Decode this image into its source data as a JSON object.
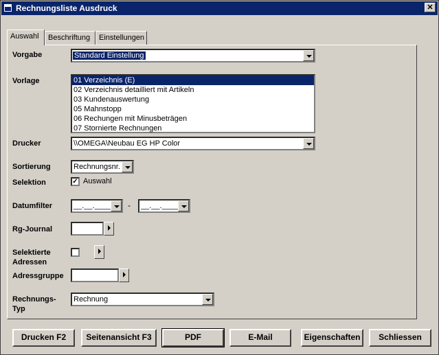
{
  "window": {
    "title": "Rechnungsliste Ausdruck",
    "close_glyph": "✕"
  },
  "tabs": [
    {
      "label": "Auswahl",
      "active": true
    },
    {
      "label": "Beschriftung",
      "active": false
    },
    {
      "label": "Einstellungen",
      "active": false
    }
  ],
  "form": {
    "vorgabe": {
      "label": "Vorgabe",
      "value": "Standard Einstellung"
    },
    "vorlage": {
      "label": "Vorlage",
      "items": [
        "01 Verzeichnis (E)",
        "02 Verzeichnis detailliert mit Artikeln",
        "03 Kundenauswertung",
        "05 Mahnstopp",
        "06 Rechungen mit Minusbeträgen",
        "07 Stornierte Rechnungen"
      ],
      "selected_index": 0
    },
    "drucker": {
      "label": "Drucker",
      "value": "\\\\OMEGA\\Neubau EG HP Color"
    },
    "sortierung": {
      "label": "Sortierung",
      "value": "Rechnungsnr."
    },
    "selektion": {
      "label": "Selektion",
      "checkbox_label": "Auswahl",
      "checked": true,
      "check_glyph": "✓"
    },
    "datumfilter": {
      "label": "Datumfilter",
      "from": "__.__.____",
      "to": "__.__.____",
      "separator": "-"
    },
    "rg_journal": {
      "label": "Rg-Journal",
      "value": ""
    },
    "selektierte_adressen": {
      "label_line1": "Selektierte",
      "label_line2": "Adressen",
      "checked": false
    },
    "adressgruppe": {
      "label": "Adressgruppe",
      "value": ""
    },
    "rechnungs_typ": {
      "label_line1": "Rechnungs-",
      "label_line2": "Typ",
      "value": "Rechnung"
    }
  },
  "buttons": {
    "drucken": "Drucken F2",
    "seitenansicht": "Seitenansicht F3",
    "pdf": "PDF",
    "email": "E-Mail",
    "eigenschaften": "Eigenschaften",
    "schliessen": "Schliessen"
  },
  "colors": {
    "titlebar": "#0a246a",
    "face": "#d4d0c8",
    "selection": "#0a246a"
  }
}
